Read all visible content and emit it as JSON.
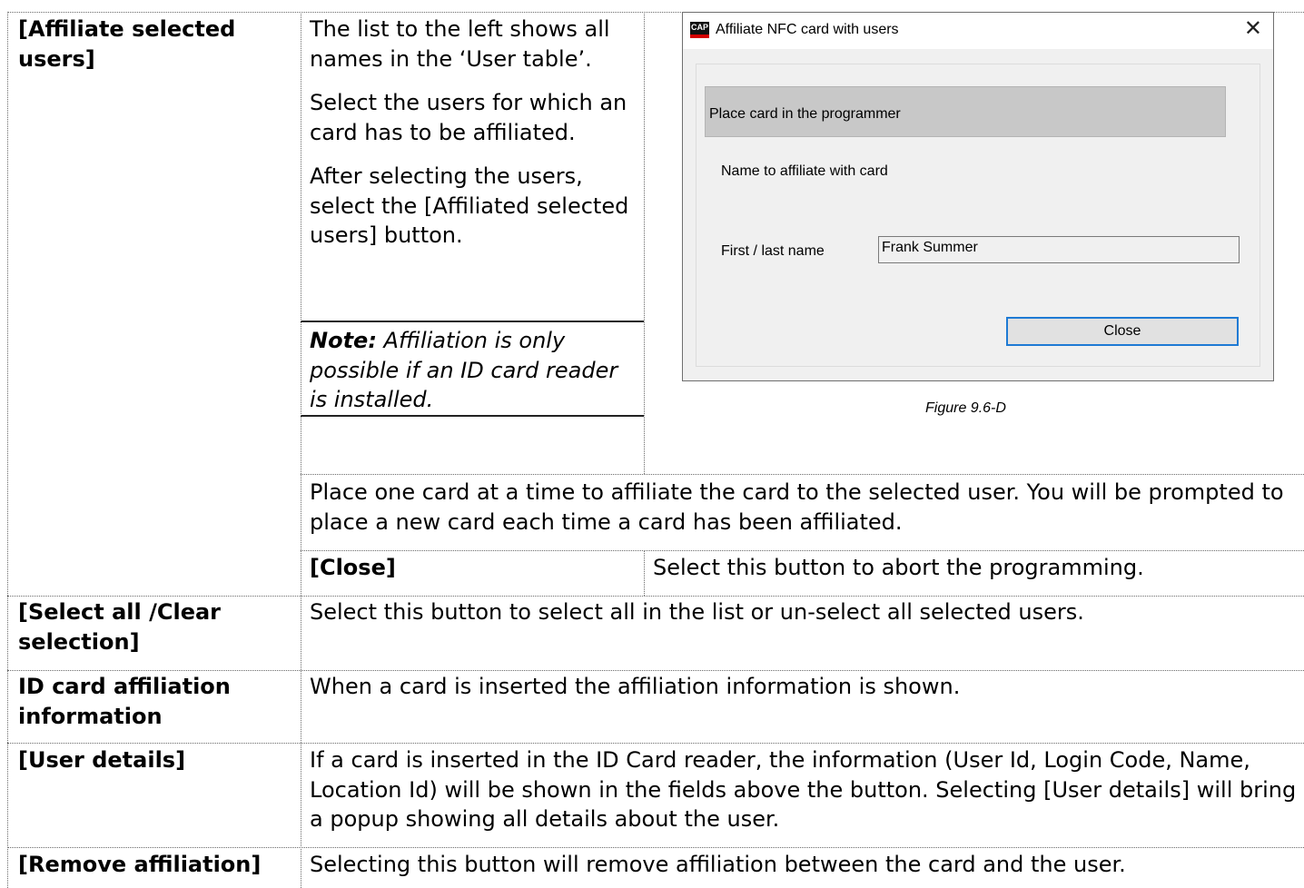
{
  "rows": {
    "affiliate": {
      "term": "[Affiliate selected users]",
      "desc_p1": "The list to the left shows all names in the ‘User table’.",
      "desc_p2": "Select the users for which an card has to be affiliated.",
      "desc_p3": "After selecting the users, select the [Affiliated selected users] button.",
      "note_label": "Note:",
      "note_text": " Affiliation is only possible if an ID card reader is installed.",
      "place_text": "Place one card at a time to affiliate the card to the selected user. You will be prompted to place a new card each time a card has been affiliated.",
      "sub_term": "[Close]",
      "sub_desc": "Select this button to abort the programming."
    },
    "select_all": {
      "term": "[Select all /Clear selection]",
      "desc": "Select this button to select all in the list or un-select all selected users."
    },
    "id_card": {
      "term": "ID card affiliation information",
      "desc": "When a card is inserted the affiliation information is shown."
    },
    "user_details": {
      "term": "[User details]",
      "desc": "If a card is inserted in the ID Card reader, the information (User Id, Login Code, Name, Location Id) will be shown in the fields above the button. Selecting [User details] will bring a popup showing all details about the user."
    },
    "remove": {
      "term": "[Remove affiliation]",
      "desc": "Selecting this button will remove affiliation between the card and the user."
    }
  },
  "dialog": {
    "logo_text": "CAP",
    "title": "Affiliate NFC card with users",
    "close_glyph": "✕",
    "banner": "Place card in the programmer",
    "section_label": "Name to affiliate with card",
    "name_label": "First / last name",
    "name_value": "Frank Summer",
    "close_button": "Close"
  },
  "figure_caption": "Figure 9.6-D"
}
